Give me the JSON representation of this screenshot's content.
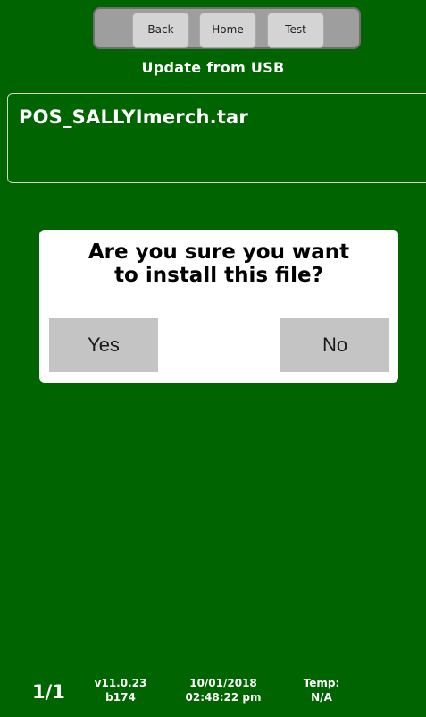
{
  "nav": {
    "back_label": "Back",
    "home_label": "Home",
    "test_label": "Test"
  },
  "screen": {
    "title": "Update from USB"
  },
  "file": {
    "name": "POS_SALLYImerch.tar"
  },
  "dialog": {
    "message_line1": "Are you sure you want",
    "message_line2": "to install this file?",
    "yes_label": "Yes",
    "no_label": "No"
  },
  "footer": {
    "page_indicator": "1/1",
    "version": "v11.0.23",
    "build": "b174",
    "date": "10/01/2018",
    "time": "02:48:22 pm",
    "temp_label": "Temp:",
    "temp_value": "N/A"
  },
  "colors": {
    "background": "#006400",
    "nav_bar": "#9e9e9e",
    "nav_button": "#d4d4d4",
    "dialog_bg": "#ffffff",
    "dialog_button": "#c4c4c4"
  }
}
